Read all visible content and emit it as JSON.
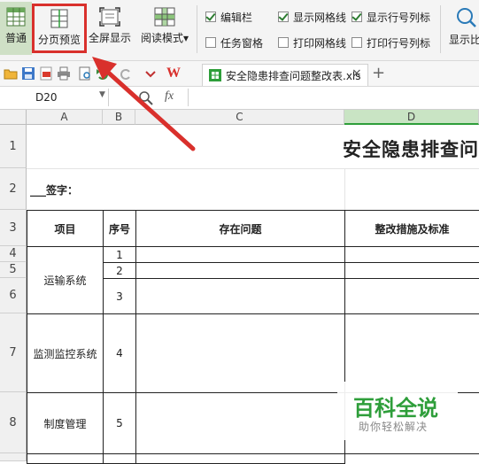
{
  "ribbon": {
    "normal_label": "普通",
    "page_break_label": "分页预览",
    "fullscreen_label": "全屏显示",
    "read_mode_label": "阅读模式",
    "checkboxes": [
      {
        "label": "编辑栏",
        "checked": true
      },
      {
        "label": "任务窗格",
        "checked": false
      },
      {
        "label": "显示网格线",
        "checked": true
      },
      {
        "label": "打印网格线",
        "checked": false
      },
      {
        "label": "显示行号列标",
        "checked": true
      },
      {
        "label": "打印行号列标",
        "checked": false
      }
    ],
    "show_ratio_label": "显示比"
  },
  "toolbar": {
    "wps_logo": "W",
    "file_tab": "安全隐患排查问题整改表.xls",
    "close": "×",
    "add": "+"
  },
  "formula_bar": {
    "cell_ref": "D20",
    "fx": "fx"
  },
  "columns": [
    "A",
    "B",
    "C",
    "D"
  ],
  "rows": [
    "1",
    "2",
    "3",
    "4",
    "5",
    "6",
    "7",
    "8"
  ],
  "sheet": {
    "title": "安全隐患排查问",
    "sign_label": "___签字：",
    "headers": {
      "item": "项目",
      "seq": "序号",
      "issue": "存在问题",
      "measure": "整改措施及标准"
    },
    "groups": [
      {
        "name": "运输系统",
        "seqs": [
          "1",
          "2",
          "3"
        ]
      },
      {
        "name": "监测监控系统",
        "seqs": [
          "4"
        ]
      },
      {
        "name": "制度管理",
        "seqs": [
          "5"
        ]
      }
    ]
  },
  "watermark": {
    "title": "百科全说",
    "subtitle": "助你轻松解决"
  },
  "colors": {
    "accent_red": "#d9302c",
    "green": "#2e9e3a",
    "active_col": "#c9e4c4"
  }
}
